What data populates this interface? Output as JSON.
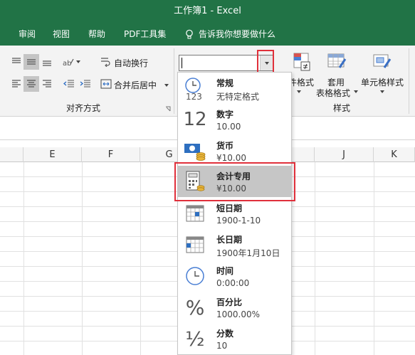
{
  "window": {
    "title": "工作簿1 - Excel"
  },
  "tabs": [
    "审阅",
    "视图",
    "帮助",
    "PDF工具集"
  ],
  "tell_me": "告诉我你想要做什么",
  "ribbon": {
    "wrap_text": "自动换行",
    "merge_center": "合并后居中",
    "alignment_group": "对齐方式",
    "number_format_value": "",
    "conditional_format": "件格式",
    "format_as_table_line1": "套用",
    "format_as_table_line2": "表格格式",
    "cell_styles": "单元格样式",
    "styles_group": "样式"
  },
  "columns": [
    "E",
    "F",
    "G",
    "J",
    "K"
  ],
  "number_formats": [
    {
      "name": "常规",
      "example": "无特定格式",
      "icon": "clock-123-icon"
    },
    {
      "name": "数字",
      "example": "10.00",
      "icon": "number-12-icon"
    },
    {
      "name": "货币",
      "example": "¥10.00",
      "icon": "currency-icon"
    },
    {
      "name": "会计专用",
      "example": "¥10.00",
      "icon": "accounting-icon",
      "selected": true
    },
    {
      "name": "短日期",
      "example": "1900-1-10",
      "icon": "short-date-icon"
    },
    {
      "name": "长日期",
      "example": "1900年1月10日",
      "icon": "long-date-icon"
    },
    {
      "name": "时间",
      "example": "0:00:00",
      "icon": "time-icon"
    },
    {
      "name": "百分比",
      "example": "1000.00%",
      "icon": "percent-icon"
    },
    {
      "name": "分数",
      "example": "10",
      "icon": "fraction-icon"
    }
  ],
  "colors": {
    "excel_green": "#217346",
    "highlight_red": "#e0303b",
    "selected_gray": "#c6c6c6"
  }
}
